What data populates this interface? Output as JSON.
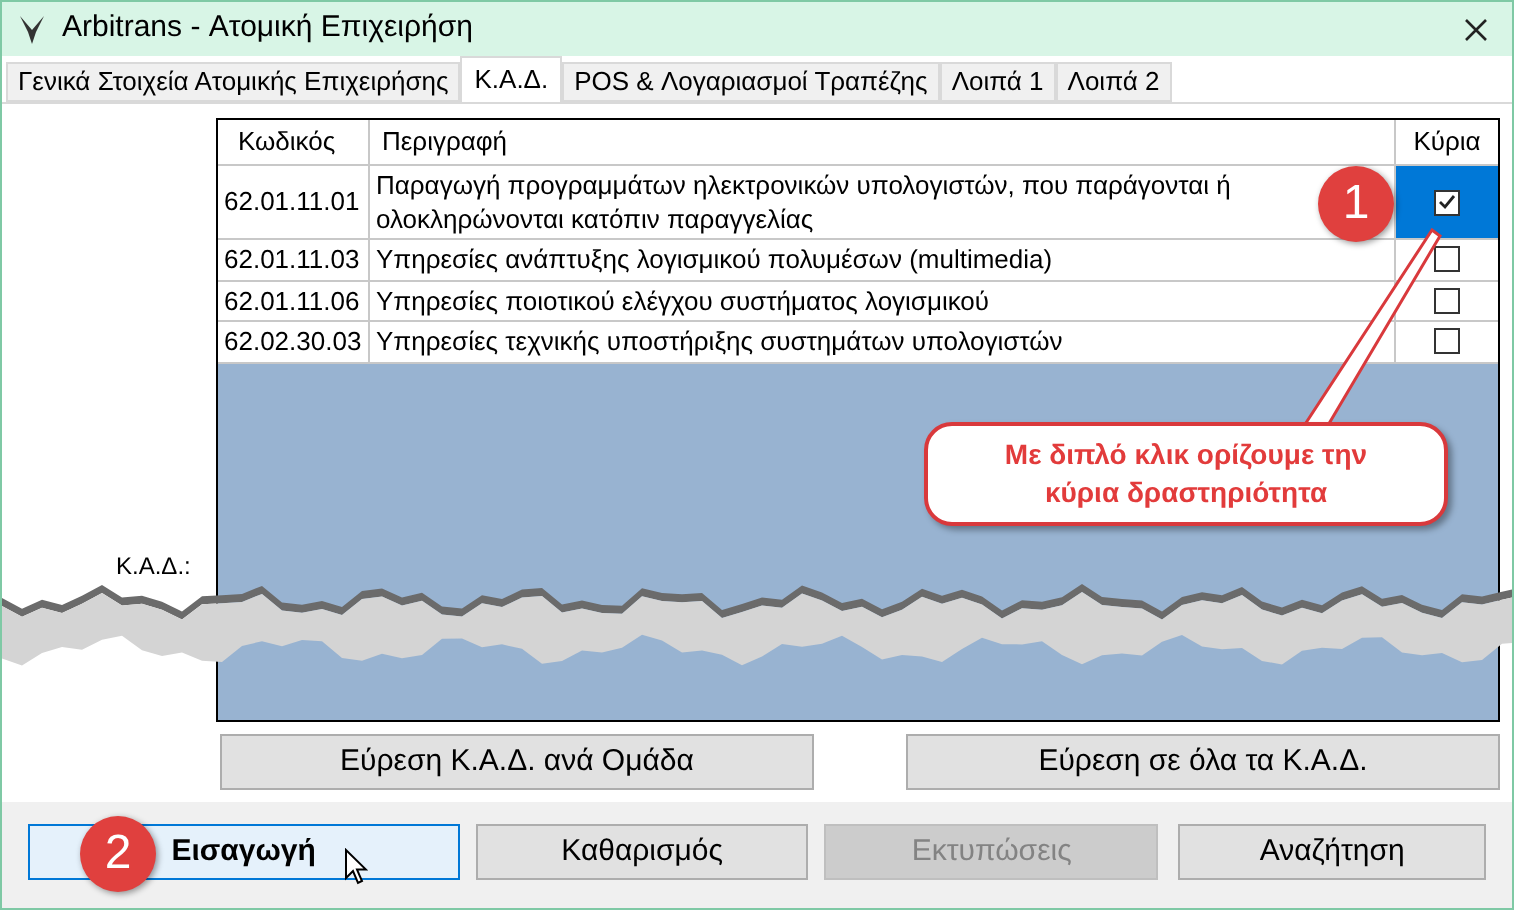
{
  "window": {
    "title": "Arbitrans - Ατομική Επιχειρήση"
  },
  "tabs": [
    {
      "label": "Γενικά Στοιχεία Ατομικής Επιχειρήσης",
      "selected": false
    },
    {
      "label": "Κ.Α.Δ.",
      "selected": true
    },
    {
      "label": "POS & Λογαριασμοί Τραπέζης",
      "selected": false
    },
    {
      "label": "Λοιπά 1",
      "selected": false
    },
    {
      "label": "Λοιπά 2",
      "selected": false
    }
  ],
  "kad_label": "Κ.Α.Δ.:",
  "table": {
    "columns": [
      "Κωδικός",
      "Περιγραφή",
      "Κύρια"
    ],
    "rows": [
      {
        "code": "62.01.11.01",
        "description": "Παραγωγή προγραμμάτων ηλεκτρονικών υπολογιστών, που παράγονται ή ολοκληρώνονται κατόπιν παραγγελίας",
        "main": true,
        "selected": true
      },
      {
        "code": "62.01.11.03",
        "description": "Υπηρεσίες ανάπτυξης λογισμικού πολυμέσων (multimedia)",
        "main": false,
        "selected": false
      },
      {
        "code": "62.01.11.06",
        "description": "Υπηρεσίες ποιοτικού ελέγχου συστήματος λογισμικού",
        "main": false,
        "selected": false
      },
      {
        "code": "62.02.30.03",
        "description": "Υπηρεσίες τεχνικής υποστήριξης συστημάτων υπολογιστών",
        "main": false,
        "selected": false
      }
    ]
  },
  "search_buttons": [
    "Εύρεση Κ.Α.Δ. ανά Ομάδα",
    "Εύρεση σε όλα τα Κ.Α.Δ."
  ],
  "buttons": [
    {
      "label": "Εισαγωγή",
      "default": true,
      "disabled": false
    },
    {
      "label": "Καθαρισμός",
      "default": false,
      "disabled": false
    },
    {
      "label": "Εκτυπώσεις",
      "default": false,
      "disabled": true
    },
    {
      "label": "Αναζήτηση",
      "default": false,
      "disabled": false
    }
  ],
  "annotations": {
    "badges": [
      "1",
      "2"
    ],
    "callout": "Με διπλό κλικ ορίζουμε την κύρια δραστηριότητα"
  }
}
